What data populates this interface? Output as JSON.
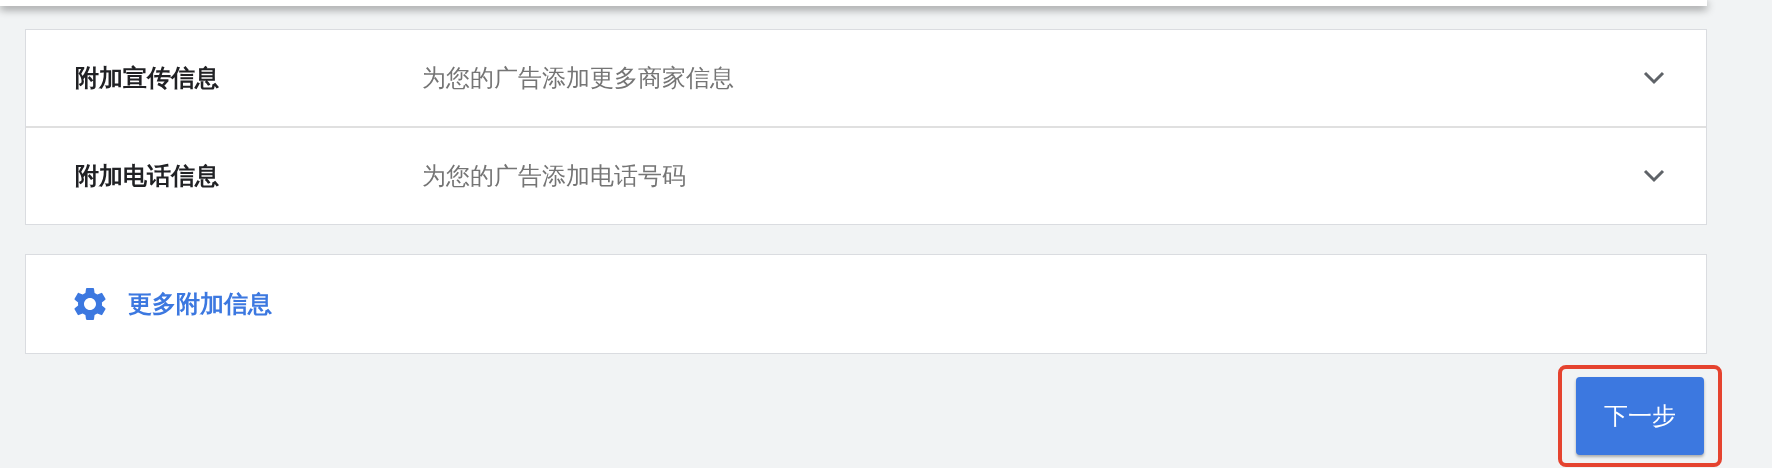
{
  "extensions": [
    {
      "label": "附加宣传信息",
      "description": "为您的广告添加更多商家信息",
      "expanded": false
    },
    {
      "label": "附加电话信息",
      "description": "为您的广告添加电话号码",
      "expanded": false
    }
  ],
  "more": {
    "label": "更多附加信息"
  },
  "next_button": {
    "label": "下一步",
    "highlighted": true
  }
}
